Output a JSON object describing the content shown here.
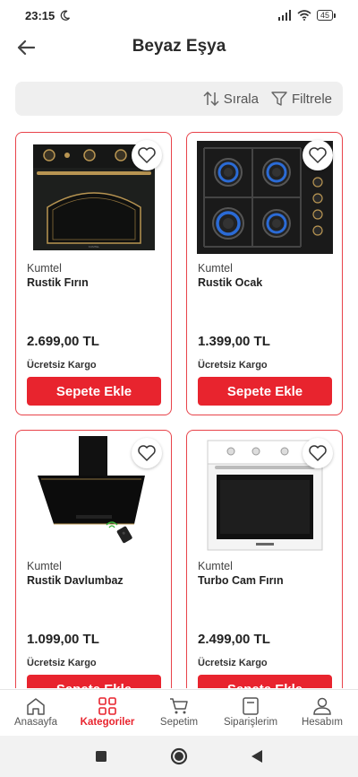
{
  "status_bar": {
    "time": "23:15",
    "battery": "45"
  },
  "header": {
    "title": "Beyaz Eşya"
  },
  "toolbar": {
    "sort_label": "Sırala",
    "filter_label": "Filtrele"
  },
  "products": [
    {
      "brand": "Kumtel",
      "name": "Rustik Fırın",
      "price": "2.699,00 TL",
      "shipping": "Ücretsiz Kargo",
      "button": "Sepete Ekle",
      "icon": "rustic-oven-image"
    },
    {
      "brand": "Kumtel",
      "name": "Rustik Ocak",
      "price": "1.399,00 TL",
      "shipping": "Ücretsiz Kargo",
      "button": "Sepete Ekle",
      "icon": "gas-hob-image"
    },
    {
      "brand": "Kumtel",
      "name": "Rustik Davlumbaz",
      "price": "1.099,00 TL",
      "shipping": "Ücretsiz Kargo",
      "button": "Sepete Ekle",
      "icon": "cooker-hood-image"
    },
    {
      "brand": "Kumtel",
      "name": "Turbo Cam Fırın",
      "price": "2.499,00 TL",
      "shipping": "Ücretsiz Kargo",
      "button": "Sepete Ekle",
      "icon": "glass-oven-image"
    }
  ],
  "bottom_nav": {
    "items": [
      {
        "label": "Anasayfa",
        "icon": "home-icon"
      },
      {
        "label": "Kategoriler",
        "icon": "grid-icon",
        "active": true
      },
      {
        "label": "Sepetim",
        "icon": "cart-icon"
      },
      {
        "label": "Siparişlerim",
        "icon": "orders-icon"
      },
      {
        "label": "Hesabım",
        "icon": "user-icon"
      }
    ]
  },
  "colors": {
    "accent": "#e8242e",
    "card_border": "#e8434a",
    "toolbar_bg": "#efefef"
  }
}
